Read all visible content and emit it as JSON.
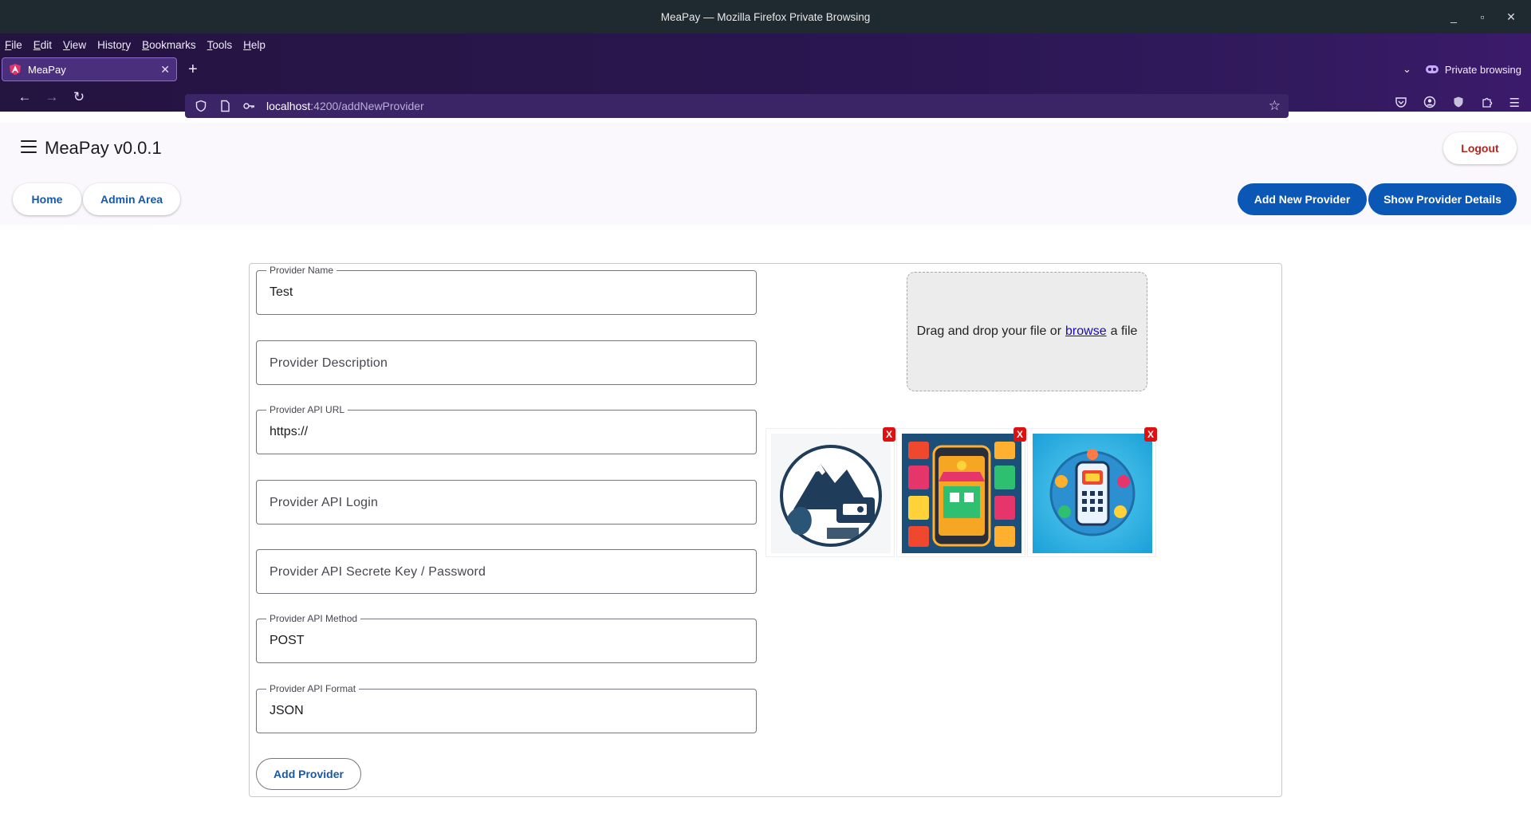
{
  "window": {
    "title": "MeaPay — Mozilla Firefox Private Browsing",
    "controls": [
      "_",
      "▫",
      "✕"
    ]
  },
  "menubar": [
    {
      "label": "File"
    },
    {
      "label": "Edit"
    },
    {
      "label": "View"
    },
    {
      "label": "History"
    },
    {
      "label": "Bookmarks"
    },
    {
      "label": "Tools"
    },
    {
      "label": "Help"
    }
  ],
  "tab": {
    "title": "MeaPay",
    "close": "✕",
    "new_tab": "+"
  },
  "private_badge": "Private browsing",
  "url": {
    "host": "localhost",
    "path": ":4200/addNewProvider"
  },
  "app": {
    "title": "MeaPay v0.0.1",
    "logout": "Logout",
    "nav": {
      "home": "Home",
      "admin": "Admin Area"
    },
    "nav_right": {
      "add_new_provider": "Add New Provider",
      "show_provider_details": "Show Provider Details"
    }
  },
  "form": {
    "provider_name": {
      "label": "Provider Name",
      "value": "Test"
    },
    "provider_description": {
      "placeholder": "Provider Description"
    },
    "provider_api_url": {
      "label": "Provider API URL",
      "value": "https://"
    },
    "provider_api_login": {
      "placeholder": "Provider API Login"
    },
    "provider_api_secret": {
      "placeholder": "Provider API Secrete Key / Password"
    },
    "provider_api_method": {
      "label": "Provider API Method",
      "value": "POST"
    },
    "provider_api_format": {
      "label": "Provider API Format",
      "value": "JSON"
    },
    "submit": "Add Provider"
  },
  "dropzone": {
    "before": "Drag and drop your file or",
    "link": "browse",
    "after": "a file"
  },
  "thumbnails": [
    {
      "remove": "X",
      "icon": "mountain-wave-logo-icon"
    },
    {
      "remove": "X",
      "icon": "phone-shop-illustration-icon"
    },
    {
      "remove": "X",
      "icon": "phone-apps-illustration-icon"
    }
  ],
  "colors": {
    "primary": "#0b57b5",
    "danger": "#b3261e",
    "firefox_purple": "#2a1650"
  }
}
